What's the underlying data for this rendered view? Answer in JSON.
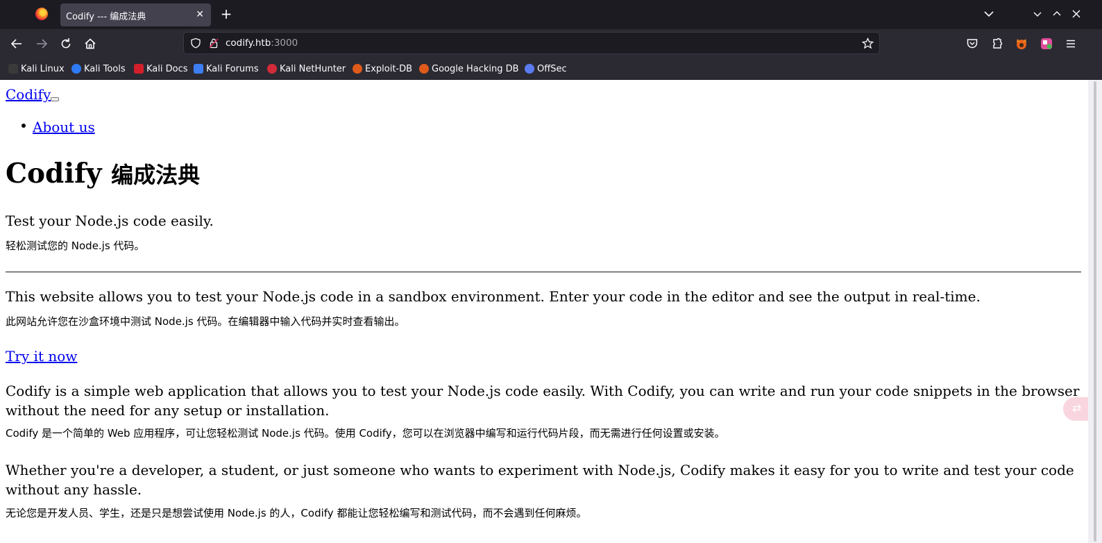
{
  "browser": {
    "tab_title": "Codify --- 编成法典",
    "tab_close": "✕",
    "new_tab": "+",
    "url_host": "codify.htb",
    "url_port": ":3000"
  },
  "bookmarks": [
    {
      "label": "Kali Linux",
      "color": "#1f1f1f"
    },
    {
      "label": "Kali Tools",
      "color": "#2f7bf5"
    },
    {
      "label": "Kali Docs",
      "color": "#d41f2b"
    },
    {
      "label": "Kali Forums",
      "color": "#3d7ff2"
    },
    {
      "label": "Kali NetHunter",
      "color": "#d42b3a"
    },
    {
      "label": "Exploit-DB",
      "color": "#e05a1a"
    },
    {
      "label": "Google Hacking DB",
      "color": "#e05a1a"
    },
    {
      "label": "OffSec",
      "color": "#5b7bf0"
    }
  ],
  "page": {
    "brand": "Codify",
    "nav_about": "About us",
    "heading_en": "Codify",
    "heading_cn": "编成法典",
    "lead_en": "Test your Node.js code easily.",
    "lead_cn": "轻松测试您的 Node.js 代码。",
    "desc_en": "This website allows you to test your Node.js code in a sandbox environment. Enter your code in the editor and see the output in real-time.",
    "desc_cn": "此网站允许您在沙盒环境中测试 Node.js 代码。在编辑器中输入代码并实时查看输出。",
    "try_now": "Try it now",
    "para1_en": "Codify is a simple web application that allows you to test your Node.js code easily. With Codify, you can write and run your code snippets in the browser without the need for any setup or installation.",
    "para1_cn": "Codify 是一个简单的 Web 应用程序，可让您轻松测试 Node.js 代码。使用 Codify，您可以在浏览器中编写和运行代码片段，而无需进行任何设置或安装。",
    "para2_en": "Whether you're a developer, a student, or just someone who wants to experiment with Node.js, Codify makes it easy for you to write and test your code without any hassle.",
    "para2_cn": "无论您是开发人员、学生，还是只是想尝试使用 Node.js 的人，Codify 都能让您轻松编写和测试代码，而不会遇到任何麻烦。"
  },
  "colors": {
    "link": "#0000ee",
    "chrome_dark": "#1c1b22",
    "chrome_toolbar": "#2b2a33"
  }
}
